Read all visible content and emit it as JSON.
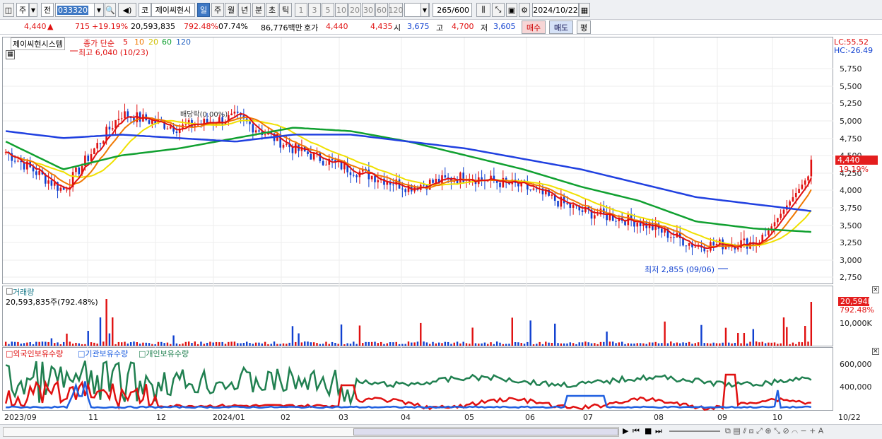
{
  "toolbar": {
    "market": "주",
    "mode": "전",
    "code": "033320",
    "market_btn": "코",
    "stock_name": "제이씨현시",
    "periods": [
      "일",
      "주",
      "월",
      "년",
      "분",
      "초",
      "틱"
    ],
    "active_period": "일",
    "intervals": [
      "1",
      "3",
      "5",
      "10",
      "20",
      "30",
      "60",
      "120"
    ],
    "count": "265",
    "count_max": "/600",
    "date": "2024/10/22"
  },
  "quote": {
    "price": "4,440",
    "change_arrow": "▲",
    "change": "715",
    "change_pct": "+19.19%",
    "volume": "20,593,835",
    "vol_ratio": "792.48%",
    "turnover": "07.74%",
    "amount": "86,776백만",
    "ask_label": "호가",
    "ask": "4,440",
    "bid": "4,435",
    "open_label": "시",
    "open": "3,675",
    "high_label": "고",
    "high": "4,700",
    "low_label": "저",
    "low": "3,605",
    "buy_btn": "매수",
    "sell_btn": "매도",
    "eval_btn": "평"
  },
  "price_panel": {
    "title": "제이씨현시스템",
    "ma_label": "종가 단순",
    "ma_periods": [
      "5",
      "10",
      "20",
      "60",
      "120"
    ],
    "lc": "LC:55.52",
    "hc": "HC:-26.49",
    "high_annot": "최고 6,040 (10/23)",
    "low_annot": "최저 2,855 (09/06)",
    "dividend_annot": "배당락(0.00%)",
    "y_ticks": [
      "5,750",
      "5,500",
      "5,250",
      "5,000",
      "4,750",
      "4,500",
      "4,250",
      "4,000",
      "3,750",
      "3,500",
      "3,250",
      "3,000",
      "2,750"
    ],
    "current_badge": "4,440",
    "current_pct": "19.19%"
  },
  "volume_panel": {
    "title": "거래량",
    "value_text": "20,593,835주(792.48%)",
    "y_ticks": [
      "10,000K"
    ],
    "badge": "20,594K",
    "badge_pct": "792.48%"
  },
  "holding_panel": {
    "legend": [
      "외국인보유수량",
      "기관보유수량",
      "개인보유수량"
    ],
    "y_ticks": [
      "600,000",
      "400,000"
    ]
  },
  "x_axis": [
    "2023/09",
    "11",
    "12",
    "2024/01",
    "02",
    "03",
    "04",
    "05",
    "06",
    "07",
    "08",
    "09",
    "10",
    "10/22"
  ],
  "colors": {
    "ma5": "#e01010",
    "ma10": "#f07800",
    "ma20": "#f0e000",
    "ma60": "#10a030",
    "ma120": "#2040e0",
    "up": "#e01010",
    "down": "#1040d0",
    "foreign": "#e01010",
    "inst": "#2060e0",
    "retail": "#208050"
  },
  "chart_data": {
    "type": "line",
    "title": "제이씨현시스템",
    "x": [
      "2023/09",
      "11",
      "12",
      "2024/01",
      "02",
      "03",
      "04",
      "05",
      "06",
      "07",
      "08",
      "09",
      "10",
      "10/22"
    ],
    "series": [
      {
        "name": "종가 단순 5",
        "values": [
          4550,
          4000,
          5100,
          4900,
          5050,
          4600,
          4300,
          4050,
          4200,
          4050,
          3700,
          3550,
          3200,
          3250,
          3700
        ]
      },
      {
        "name": "60",
        "values": [
          4700,
          4300,
          4500,
          4600,
          4750,
          4900,
          4850,
          4700,
          4500,
          4300,
          4050,
          3850,
          3550,
          3450,
          3400
        ]
      },
      {
        "name": "120",
        "values": [
          4850,
          4750,
          4800,
          4750,
          4700,
          4800,
          4800,
          4700,
          4600,
          4450,
          4300,
          4100,
          3900,
          3800,
          3700
        ]
      }
    ],
    "ylim": [
      2750,
      5750
    ]
  }
}
